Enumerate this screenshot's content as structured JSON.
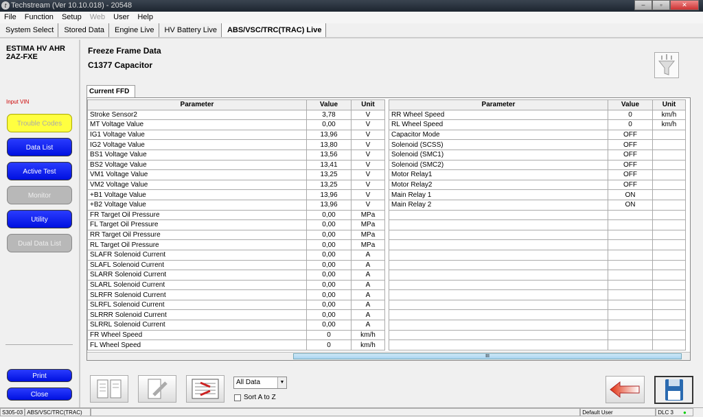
{
  "window": {
    "title": "Techstream (Ver 10.10.018) - 20548",
    "app_icon_letter": "t"
  },
  "menu": [
    "File",
    "Function",
    "Setup",
    "Web",
    "User",
    "Help"
  ],
  "tabs": [
    "System Select",
    "Stored Data",
    "Engine Live",
    "HV Battery Live",
    "ABS/VSC/TRC(TRAC) Live"
  ],
  "sidebar": {
    "vehicle_line1": "ESTIMA HV AHR",
    "vehicle_line2": "2AZ-FXE",
    "input_vin": "Input VIN",
    "buttons": [
      "Trouble Codes",
      "Data List",
      "Active Test",
      "Monitor",
      "Utility",
      "Dual Data List"
    ],
    "print": "Print",
    "close": "Close"
  },
  "main": {
    "title": "Freeze Frame Data",
    "subtitle": "C1377 Capacitor",
    "ffd_tab": "Current FFD",
    "headers": {
      "parameter": "Parameter",
      "value": "Value",
      "unit": "Unit"
    },
    "left_rows": [
      [
        "Stroke Sensor2",
        "3,78",
        "V"
      ],
      [
        "MT Voltage Value",
        "0,00",
        "V"
      ],
      [
        "IG1 Voltage Value",
        "13,96",
        "V"
      ],
      [
        "IG2 Voltage Value",
        "13,80",
        "V"
      ],
      [
        "BS1 Voltage Value",
        "13,56",
        "V"
      ],
      [
        "BS2 Voltage Value",
        "13,41",
        "V"
      ],
      [
        "VM1 Voltage Value",
        "13,25",
        "V"
      ],
      [
        "VM2 Voltage Value",
        "13,25",
        "V"
      ],
      [
        "+B1 Voltage Value",
        "13,96",
        "V"
      ],
      [
        "+B2 Voltage Value",
        "13,96",
        "V"
      ],
      [
        "FR Target Oil Pressure",
        "0,00",
        "MPa"
      ],
      [
        "FL Target Oil Pressure",
        "0,00",
        "MPa"
      ],
      [
        "RR Target Oil Pressure",
        "0,00",
        "MPa"
      ],
      [
        "RL Target Oil Pressure",
        "0,00",
        "MPa"
      ],
      [
        "SLAFR Solenoid Current",
        "0,00",
        "A"
      ],
      [
        "SLAFL Solenoid Current",
        "0,00",
        "A"
      ],
      [
        "SLARR Solenoid Current",
        "0,00",
        "A"
      ],
      [
        "SLARL Solenoid Current",
        "0,00",
        "A"
      ],
      [
        "SLRFR Solenoid Current",
        "0,00",
        "A"
      ],
      [
        "SLRFL Solenoid Current",
        "0,00",
        "A"
      ],
      [
        "SLRRR Solenoid Current",
        "0,00",
        "A"
      ],
      [
        "SLRRL Solenoid Current",
        "0,00",
        "A"
      ],
      [
        "FR Wheel Speed",
        "0",
        "km/h"
      ],
      [
        "FL Wheel Speed",
        "0",
        "km/h"
      ]
    ],
    "right_rows": [
      [
        "RR Wheel Speed",
        "0",
        "km/h"
      ],
      [
        "RL Wheel Speed",
        "0",
        "km/h"
      ],
      [
        "Capacitor Mode",
        "OFF",
        ""
      ],
      [
        "Solenoid (SCSS)",
        "OFF",
        ""
      ],
      [
        "Solenoid (SMC1)",
        "OFF",
        ""
      ],
      [
        "Solenoid (SMC2)",
        "OFF",
        ""
      ],
      [
        "Motor Relay1",
        "OFF",
        ""
      ],
      [
        "Motor Relay2",
        "OFF",
        ""
      ],
      [
        "Main Relay 1",
        "ON",
        ""
      ],
      [
        "Main Relay 2",
        "ON",
        ""
      ]
    ],
    "scroll_thumb_glyph": "III"
  },
  "toolbar": {
    "filter_value": "All Data",
    "sort_label": "Sort A to Z",
    "sort_checked": false
  },
  "status": {
    "code": "S305-03",
    "system": "ABS/VSC/TRC(TRAC)",
    "user": "Default User",
    "dlc": "DLC 3",
    "dlc_color": "#00cc00"
  }
}
